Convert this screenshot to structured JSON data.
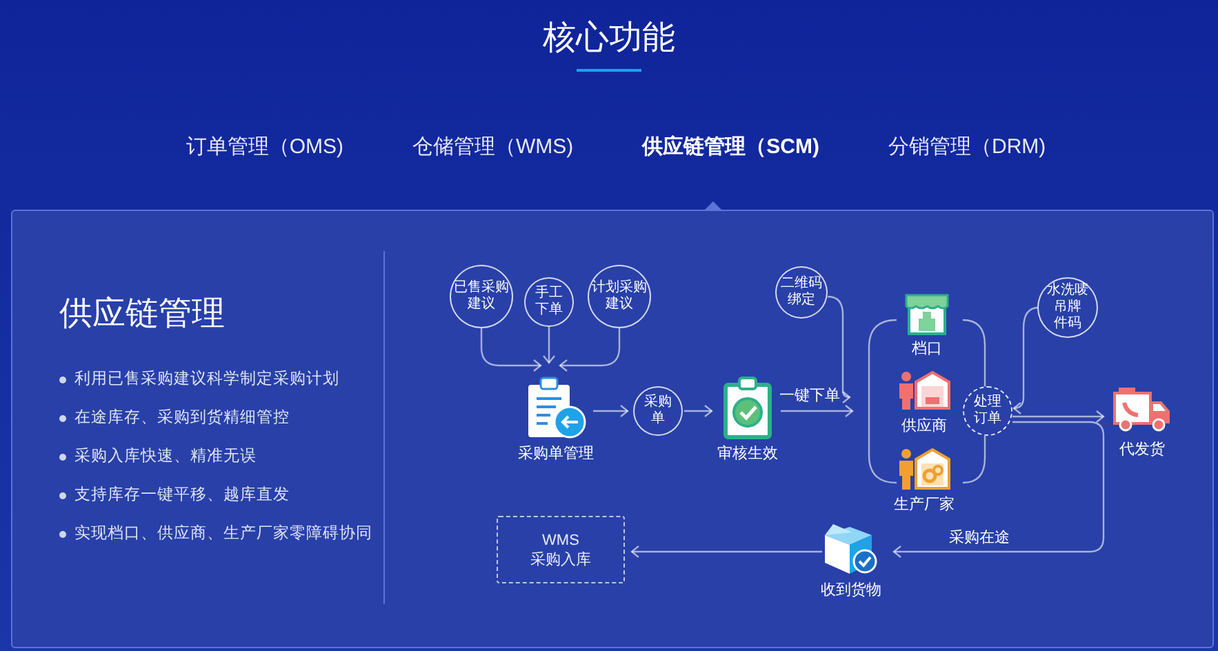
{
  "section_title": "核心功能",
  "tabs": [
    {
      "label": "订单管理（OMS)",
      "selected": false
    },
    {
      "label": "仓储管理（WMS)",
      "selected": false
    },
    {
      "label": "供应链管理（SCM)",
      "selected": true
    },
    {
      "label": "分销管理（DRM)",
      "selected": false
    }
  ],
  "panel": {
    "heading": "供应链管理",
    "bullets": [
      "利用已售采购建议科学制定采购计划",
      "在途库存、采购到货精细管控",
      "采购入库快速、精准无误",
      "支持库存一键平移、越库直发",
      "实现档口、供应商、生产厂家零障碍协同"
    ]
  },
  "diagram": {
    "bubbles": [
      {
        "lines": [
          "已售采购",
          "建议"
        ],
        "kind": "solid"
      },
      {
        "lines": [
          "手工",
          "下单"
        ],
        "kind": "solid"
      },
      {
        "lines": [
          "计划采购",
          "建议"
        ],
        "kind": "solid"
      },
      {
        "lines": [
          "二维码",
          "绑定"
        ],
        "kind": "solid"
      },
      {
        "lines": [
          "水洗唛",
          "吊牌",
          "件码"
        ],
        "kind": "solid"
      },
      {
        "lines": [
          "采购",
          "单"
        ],
        "kind": "solid"
      },
      {
        "lines": [
          "处理",
          "订单"
        ],
        "kind": "dashed"
      }
    ],
    "nodes": [
      {
        "label": "采购单管理"
      },
      {
        "label": "审核生效"
      },
      {
        "label": "档口"
      },
      {
        "label": "供应商"
      },
      {
        "label": "生产厂家"
      },
      {
        "label": "代发货"
      },
      {
        "label": "收到货物"
      }
    ],
    "edge_labels": [
      "一键下单",
      "采购在途"
    ],
    "wms_box": {
      "lines": [
        "WMS",
        "采购入库"
      ]
    }
  }
}
